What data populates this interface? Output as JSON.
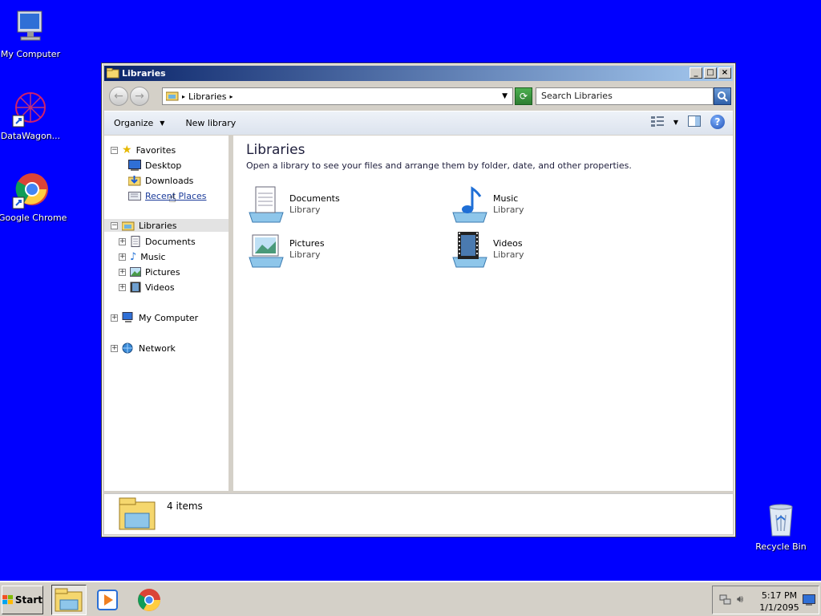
{
  "desktop": {
    "icons": [
      {
        "label": "My Computer"
      },
      {
        "label": "DataWagon..."
      },
      {
        "label": "Google Chrome"
      },
      {
        "label": "Recycle Bin"
      }
    ]
  },
  "window": {
    "title": "Libraries",
    "address": {
      "crumb": "Libraries"
    },
    "search": {
      "placeholder": "Search Libraries"
    },
    "toolbar": {
      "organize": "Organize",
      "new_library": "New library"
    },
    "nav": {
      "favorites": "Favorites",
      "desktop": "Desktop",
      "downloads": "Downloads",
      "recent_places": "Recent Places",
      "libraries": "Libraries",
      "documents": "Documents",
      "music": "Music",
      "pictures": "Pictures",
      "videos": "Videos",
      "my_computer": "My Computer",
      "network": "Network"
    },
    "content": {
      "heading": "Libraries",
      "subtitle": "Open a library to see your files and arrange them by folder, date, and other properties.",
      "libraries": [
        {
          "name": "Documents",
          "type": "Library"
        },
        {
          "name": "Music",
          "type": "Library"
        },
        {
          "name": "Pictures",
          "type": "Library"
        },
        {
          "name": "Videos",
          "type": "Library"
        }
      ]
    },
    "status": {
      "count": "4 items"
    }
  },
  "taskbar": {
    "start": "Start",
    "time": "5:17 PM",
    "date": "1/1/2095"
  },
  "colors": {
    "desktop": "#0000ff",
    "titlebar_start": "#0a246a",
    "titlebar_end": "#a6caf0"
  }
}
